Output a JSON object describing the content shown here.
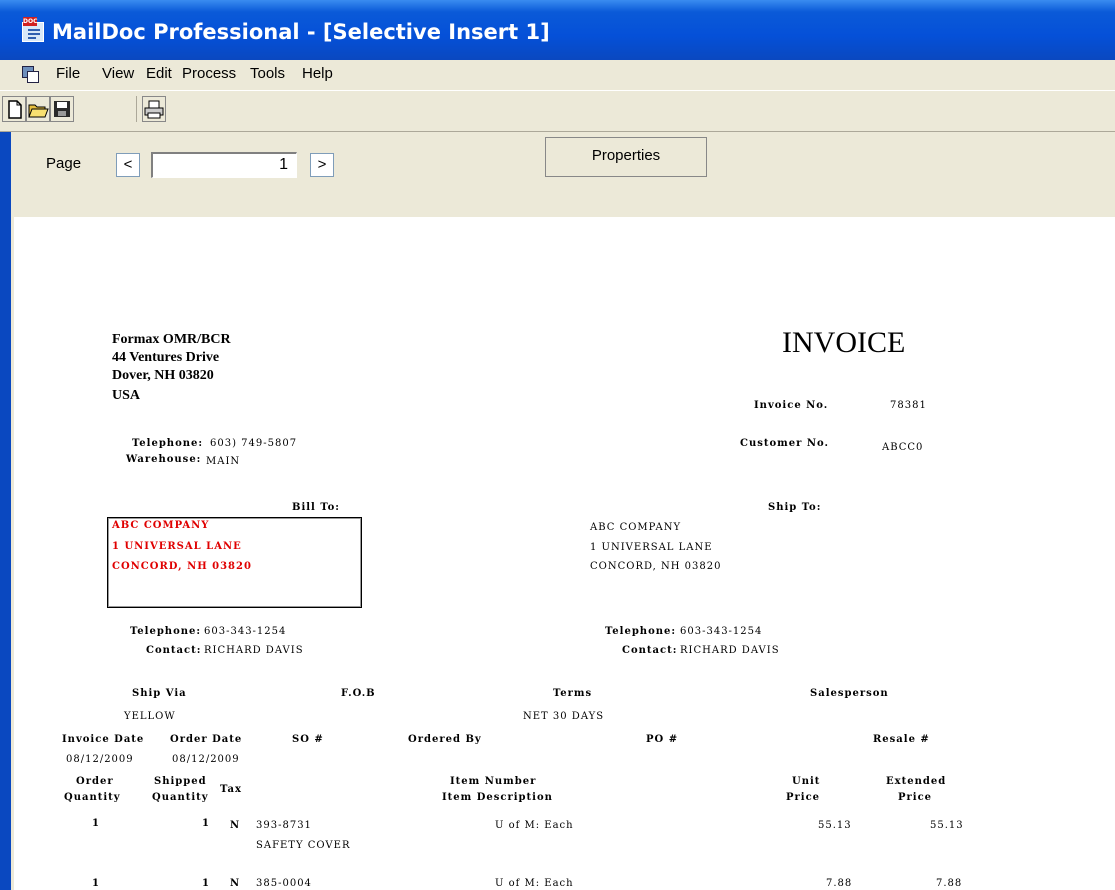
{
  "window": {
    "title": "MailDoc Professional - [Selective Insert 1]"
  },
  "menu": {
    "items": [
      "File",
      "View",
      "Edit",
      "Process",
      "Tools",
      "Help"
    ]
  },
  "nav": {
    "page_label": "Page",
    "prev": "<",
    "next": ">",
    "page_value": "1",
    "properties": "Properties"
  },
  "invoice": {
    "company": [
      "Formax OMR/BCR",
      "44 Ventures Drive",
      "Dover, NH 03820",
      "USA"
    ],
    "title": "INVOICE",
    "invoice_no_label": "Invoice No.",
    "invoice_no": "78381",
    "customer_no_label": "Customer No.",
    "customer_no": "ABCC0",
    "telephone_label": "Telephone:",
    "telephone": "603) 749-5807",
    "warehouse_label": "Warehouse:",
    "warehouse": "MAIN",
    "bill_to_label": "Bill To:",
    "bill_to": [
      "ABC COMPANY",
      "1 UNIVERSAL LANE",
      "CONCORD, NH 03820"
    ],
    "ship_to_label": "Ship To:",
    "ship_to": [
      "ABC COMPANY",
      "1 UNIVERSAL LANE",
      "CONCORD, NH 03820"
    ],
    "bill_phone_label": "Telephone:",
    "bill_phone": "603-343-1254",
    "bill_contact_label": "Contact:",
    "bill_contact": "RICHARD DAVIS",
    "ship_phone_label": "Telephone:",
    "ship_phone": "603-343-1254",
    "ship_contact_label": "Contact:",
    "ship_contact": "RICHARD DAVIS",
    "ship_via_label": "Ship Via",
    "ship_via": "YELLOW",
    "fob_label": "F.O.B",
    "terms_label": "Terms",
    "terms": "NET 30 DAYS",
    "salesperson_label": "Salesperson",
    "invoice_date_label": "Invoice Date",
    "invoice_date": "08/12/2009",
    "order_date_label": "Order Date",
    "order_date": "08/12/2009",
    "so_label": "SO #",
    "ordered_by_label": "Ordered By",
    "po_label": "PO #",
    "resale_label": "Resale #",
    "col_order_qty": [
      "Order",
      "Quantity"
    ],
    "col_shipped_qty": [
      "Shipped",
      "Quantity"
    ],
    "col_tax": "Tax",
    "col_item": [
      "Item Number",
      "Item Description"
    ],
    "col_unit": [
      "Unit",
      "Price"
    ],
    "col_ext": [
      "Extended",
      "Price"
    ],
    "lines": [
      {
        "order_qty": "1",
        "shipped_qty": "1",
        "tax": "N",
        "item": "393-8731",
        "uom": "U of M: Each",
        "unit": "55.13",
        "ext": "55.13",
        "desc": "SAFETY COVER"
      },
      {
        "order_qty": "1",
        "shipped_qty": "1",
        "tax": "N",
        "item": "385-0004",
        "uom": "U of M: Each",
        "unit": "7.88",
        "ext": "7.88",
        "desc": ""
      }
    ]
  }
}
